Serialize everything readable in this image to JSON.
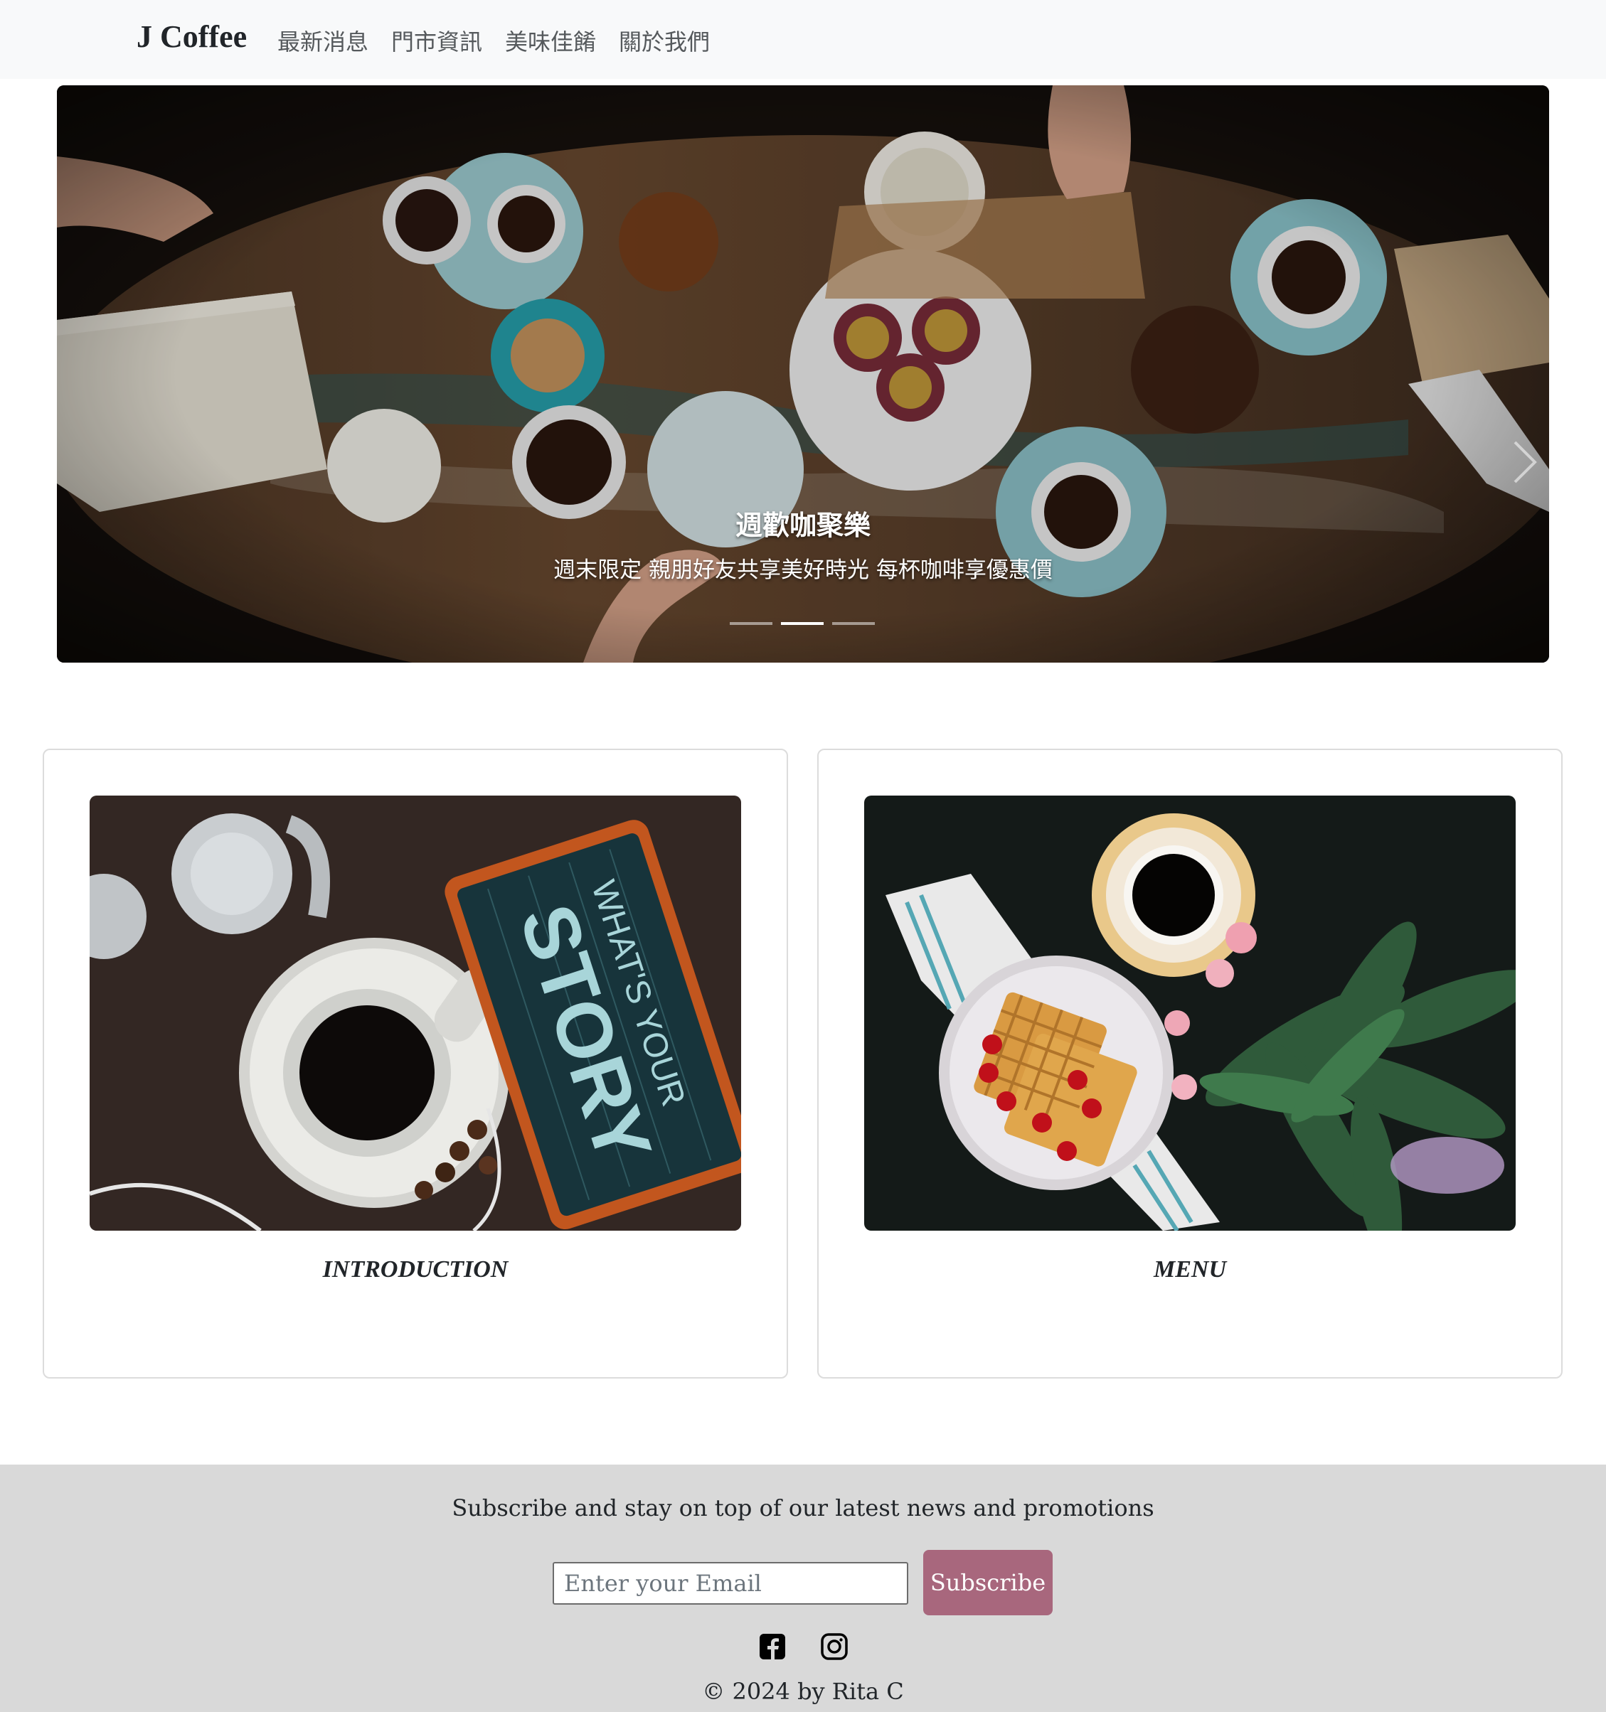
{
  "navbar": {
    "brand": "J Coffee",
    "links": [
      "最新消息",
      "門市資訊",
      "美味佳餚",
      "關於我們"
    ]
  },
  "carousel": {
    "caption_title": "週歡咖聚樂",
    "caption_text": "週末限定 親朋好友共享美好時光 每杯咖啡享優惠價",
    "slide_count": 3,
    "active_slide": 2,
    "next_icon": "chevron-right-icon"
  },
  "cards": [
    {
      "title": "INTRODUCTION",
      "image": "coffee-cup-tablet-whats-your-story"
    },
    {
      "title": "MENU",
      "image": "waffles-cherries-coffee-flowers"
    }
  ],
  "footer": {
    "subscribe_text": "Subscribe and stay on top of our latest news and promotions",
    "email_placeholder": "Enter your Email",
    "subscribe_label": "Subscribe",
    "social_icons": [
      "facebook-icon",
      "instagram-icon"
    ],
    "copyright": "© 2024 by Rita C"
  },
  "colors": {
    "navbar_bg": "#f8f9fa",
    "footer_bg": "#d9d9d9",
    "button_accent": "#a8677d"
  }
}
